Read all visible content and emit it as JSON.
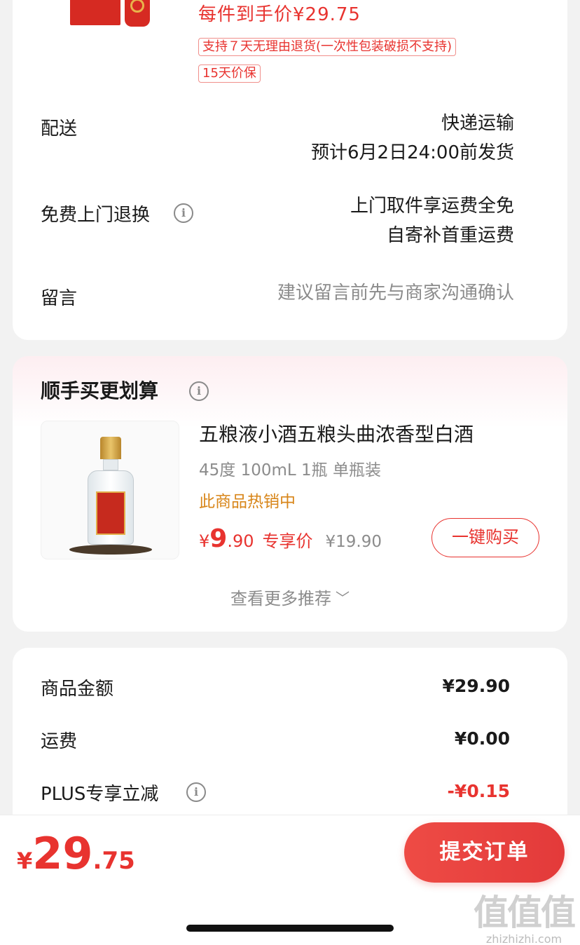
{
  "top_card": {
    "net_price_text": "每件到手价¥29.75",
    "tags": [
      "支持７天无理由退货(一次性包装破损不支持)",
      "15天价保"
    ],
    "delivery": {
      "label": "配送",
      "line1": "快递运输",
      "line2": "预计6月2日24:00前发货"
    },
    "free_return": {
      "label": "免费上门退换",
      "line1": "上门取件享运费全免",
      "line2": "自寄补首重运费"
    },
    "message": {
      "label": "留言",
      "placeholder": "建议留言前先与商家沟通确认"
    }
  },
  "recommend": {
    "title": "顺手买更划算",
    "product": {
      "name": "五粮液小酒五粮头曲浓香型白酒",
      "spec": "45度 100mL 1瓶 单瓶装",
      "hot": "此商品热销中",
      "price_yen": "¥",
      "price_int": "9",
      "price_dec": ".90",
      "exclusive_label": "专享价",
      "original_price": "¥19.90",
      "buy_label": "一键购买"
    },
    "more_label": "查看更多推荐"
  },
  "summary": {
    "rows": [
      {
        "label": "商品金额",
        "value": "¥29.90"
      },
      {
        "label": "运费",
        "value": "¥0.00"
      },
      {
        "label": "PLUS专享立减",
        "value": "-¥0.15"
      }
    ]
  },
  "bottom": {
    "total_yen": "¥",
    "total_int": "29",
    "total_dec": ".75",
    "submit_label": "提交订单"
  },
  "watermark": {
    "big": "值值值",
    "small": "zhizhizhi.com"
  },
  "icons": {
    "info": "info-icon",
    "chevron": "chevron-down-icon"
  },
  "colors": {
    "accent": "#e8332f",
    "hot": "#d8861a",
    "muted": "#8c8c8c"
  }
}
